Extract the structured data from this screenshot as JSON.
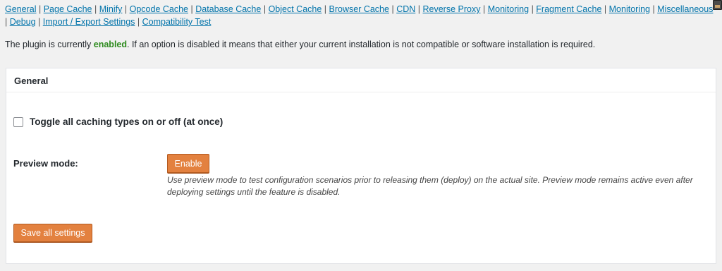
{
  "nav": {
    "links": [
      "General",
      "Page Cache",
      "Minify",
      "Opcode Cache",
      "Database Cache",
      "Object Cache",
      "Browser Cache",
      "CDN",
      "Reverse Proxy",
      "Monitoring",
      "Fragment Cache",
      "Monitoring",
      "Miscellaneous",
      "Debug",
      "Import / Export Settings",
      "Compatibility Test"
    ],
    "separator": "|"
  },
  "status": {
    "prefix": "The plugin is currently",
    "state": "enabled",
    "suffix": ". If an option is disabled it means that either your current installation is not compatible or software installation is required."
  },
  "panel": {
    "title": "General",
    "toggle_label": "Toggle all caching types on or off (at once)",
    "toggle_checked": false,
    "preview_label": "Preview mode:",
    "enable_button": "Enable",
    "preview_description": "Use preview mode to test configuration scenarios prior to releasing them (deploy) on the actual site. Preview mode remains active even after deploying settings until the feature is disabled.",
    "save_button": "Save all settings"
  },
  "colors": {
    "link": "#0073aa",
    "enabled": "#2e8b1e",
    "button": "#e3813f",
    "background": "#f1f1f1"
  }
}
